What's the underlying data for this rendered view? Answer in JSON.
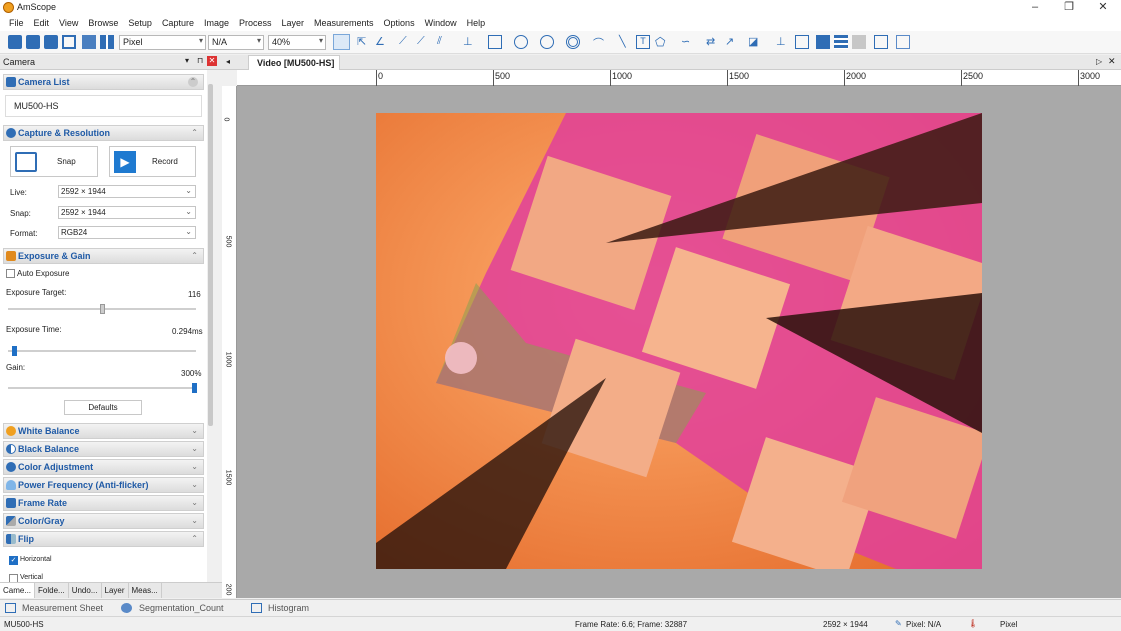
{
  "app": {
    "title": "AmScope"
  },
  "menu": [
    "File",
    "Edit",
    "View",
    "Browse",
    "Setup",
    "Capture",
    "Image",
    "Process",
    "Layer",
    "Measurements",
    "Options",
    "Window",
    "Help"
  ],
  "toolbar": {
    "unit": "Pixel",
    "magnification": "N/A",
    "zoom": "40%"
  },
  "panel": {
    "title": "Camera",
    "camera_list": {
      "title": "Camera List",
      "camera": "MU500-HS"
    },
    "capture": {
      "title": "Capture & Resolution",
      "snap": "Snap",
      "record": "Record",
      "live_label": "Live:",
      "live_value": "2592 × 1944",
      "snap_label": "Snap:",
      "snap_value": "2592 × 1944",
      "format_label": "Format:",
      "format_value": "RGB24"
    },
    "exposure": {
      "title": "Exposure & Gain",
      "auto_exposure": "Auto Exposure",
      "auto_checked": false,
      "target_label": "Exposure Target:",
      "target_value": "116",
      "target_level": 0.49,
      "time_label": "Exposure Time:",
      "time_value": "0.294ms",
      "time_level": 0.02,
      "gain_label": "Gain:",
      "gain_value": "300%",
      "gain_level": 0.98,
      "defaults": "Defaults"
    },
    "sections": [
      "White Balance",
      "Black Balance",
      "Color Adjustment",
      "Power Frequency (Anti-flicker)",
      "Frame Rate",
      "Color/Gray"
    ],
    "flip": {
      "title": "Flip",
      "horizontal": "Horizontal",
      "horizontal_checked": true,
      "vertical": "Vertical",
      "vertical_checked": false
    },
    "bottom_tabs": [
      "Came...",
      "Folde...",
      "Undo...",
      "Layer",
      "Meas..."
    ]
  },
  "doc": {
    "tab": "Video [MU500-HS]"
  },
  "ruler": {
    "h_ticks": [
      "0",
      "500",
      "1000",
      "1500",
      "2000",
      "2500",
      "3000"
    ],
    "v_ticks": [
      "0",
      "500",
      "1000",
      "1500",
      "200"
    ]
  },
  "sheet_tabs": [
    "Measurement Sheet",
    "Segmentation_Count",
    "Histogram"
  ],
  "status": {
    "camera": "MU500-HS",
    "frame": "Frame Rate: 6.6; Frame: 32887",
    "resolution": "2592 × 1944",
    "pixel": "Pixel: N/A",
    "unit": "Pixel"
  },
  "colors": {
    "accent": "#1f5aa6",
    "section_bg": "#dcdcdc",
    "canvas_bg": "#a9a9a9"
  }
}
